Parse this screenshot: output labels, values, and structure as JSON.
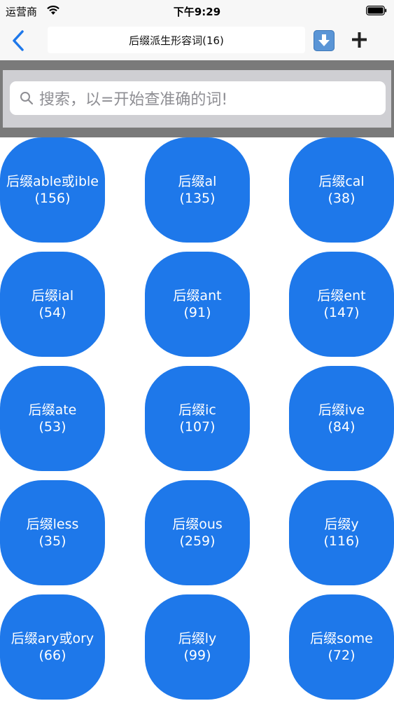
{
  "status_bar": {
    "carrier": "运营商",
    "time": "下午9:29"
  },
  "nav": {
    "title": "后缀派生形容词(16)"
  },
  "search": {
    "placeholder": "搜索，以=开始查准确的词!"
  },
  "icons": {
    "back": "chevron-left-icon",
    "download": "download-icon",
    "add": "plus-icon",
    "search": "magnifier-icon",
    "wifi": "wifi-icon",
    "battery": "battery-icon"
  },
  "colors": {
    "accent": "#1e78ea",
    "nav_background": "#f7f7f7",
    "search_frame": "#7a7a7a",
    "search_band": "#cfcfd3"
  },
  "items": [
    {
      "label": "后缀able或ible",
      "count": "(156)"
    },
    {
      "label": "后缀al",
      "count": "(135)"
    },
    {
      "label": "后缀cal",
      "count": "(38)"
    },
    {
      "label": "后缀ial",
      "count": "(54)"
    },
    {
      "label": "后缀ant",
      "count": "(91)"
    },
    {
      "label": "后缀ent",
      "count": "(147)"
    },
    {
      "label": "后缀ate",
      "count": "(53)"
    },
    {
      "label": "后缀ic",
      "count": "(107)"
    },
    {
      "label": "后缀ive",
      "count": "(84)"
    },
    {
      "label": "后缀less",
      "count": "(35)"
    },
    {
      "label": "后缀ous",
      "count": "(259)"
    },
    {
      "label": "后缀y",
      "count": "(116)"
    },
    {
      "label": "后缀ary或ory",
      "count": "(66)"
    },
    {
      "label": "后缀ly",
      "count": "(99)"
    },
    {
      "label": "后缀some",
      "count": "(72)"
    }
  ]
}
